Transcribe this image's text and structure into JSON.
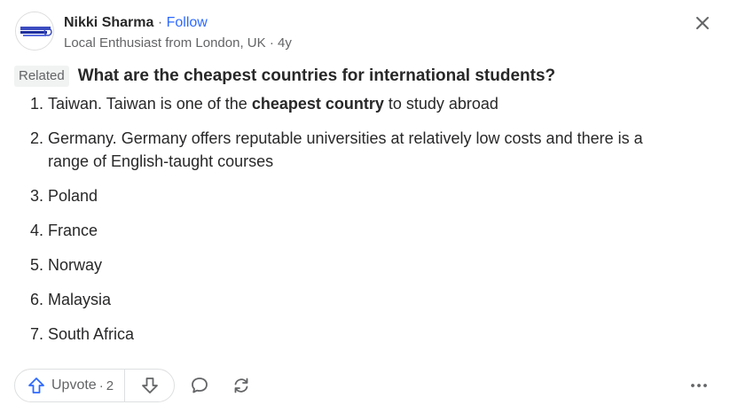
{
  "author": {
    "name": "Nikki Sharma",
    "separator": "·",
    "follow_label": "Follow",
    "credential": "Local Enthusiast from London, UK",
    "time_separator": "·",
    "time_ago": "4y"
  },
  "related": {
    "badge": "Related",
    "question": "What are the cheapest countries for international students?"
  },
  "answer": {
    "items": [
      {
        "num": "1.",
        "before": "Taiwan. Taiwan is one of the ",
        "bold": "cheapest country",
        "after": " to study abroad"
      },
      {
        "num": "2.",
        "before": "Germany. Germany offers reputable universities at relatively low costs and there is a range of English-taught courses",
        "bold": "",
        "after": ""
      },
      {
        "num": "3.",
        "before": "Poland",
        "bold": "",
        "after": ""
      },
      {
        "num": "4.",
        "before": "France",
        "bold": "",
        "after": ""
      },
      {
        "num": "5.",
        "before": "Norway",
        "bold": "",
        "after": ""
      },
      {
        "num": "6.",
        "before": "Malaysia",
        "bold": "",
        "after": ""
      },
      {
        "num": "7.",
        "before": "South Africa",
        "bold": "",
        "after": ""
      }
    ]
  },
  "actions": {
    "upvote_label": "Upvote",
    "upvote_separator": "·",
    "upvote_count": "2"
  },
  "icons": {
    "close": "close-icon",
    "upvote": "arrow-up-icon",
    "downvote": "arrow-down-icon",
    "comment": "comment-bubble-icon",
    "share": "share-reload-icon",
    "more": "more-horizontal-icon"
  },
  "colors": {
    "text": "#282829",
    "secondary_text": "#636466",
    "follow": "#2e69ff",
    "upvote_icon": "#2e69ff",
    "badge_bg": "#f1f2f2",
    "border": "#dedfe0"
  }
}
